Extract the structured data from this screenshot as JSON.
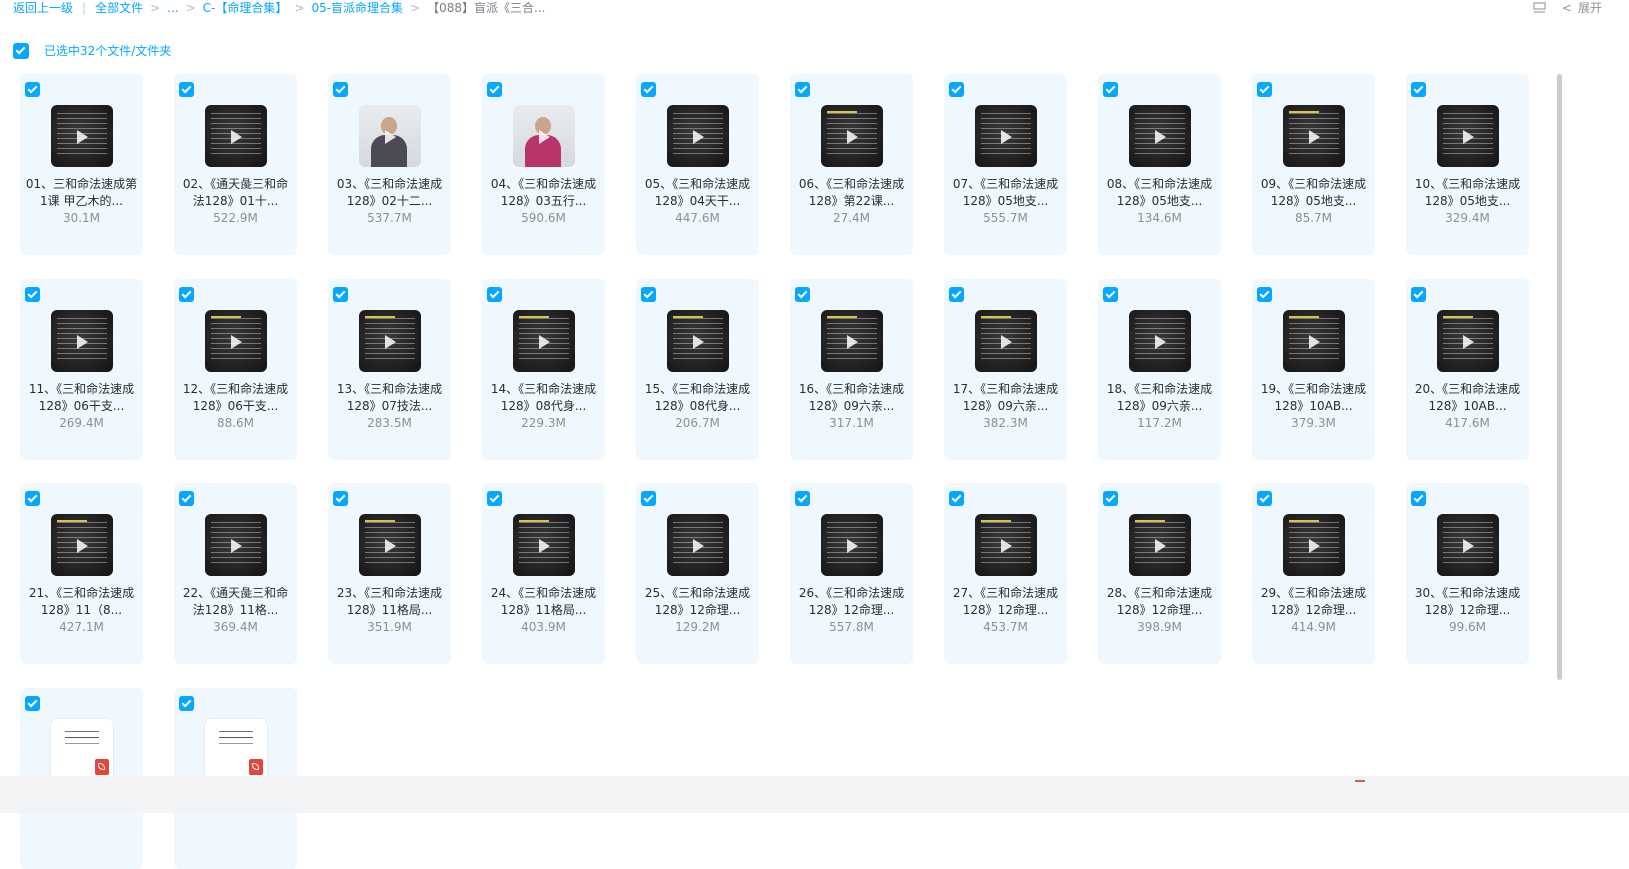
{
  "breadcrumb": {
    "back": "返回上一级",
    "all_files": "全部文件",
    "ellipsis": "...",
    "level1": "C-【命理合集】",
    "level2": "05-盲派命理合集",
    "current": "【088】盲派《三合..."
  },
  "header_right": {
    "expand_label": "展开"
  },
  "selection": {
    "summary": "已选中32个文件/文件夹"
  },
  "files": [
    {
      "name": "01、三和命法速成第1课 甲乙木的...",
      "size": "30.1M",
      "thumb": "dark"
    },
    {
      "name": "02、《通天彘三和命法128》01十...",
      "size": "522.9M",
      "thumb": "dark"
    },
    {
      "name": "03、《三和命法速成128》02十二...",
      "size": "537.7M",
      "thumb": "person"
    },
    {
      "name": "04、《三和命法速成128》03五行...",
      "size": "590.6M",
      "thumb": "person-pink"
    },
    {
      "name": "05、《三和命法速成128》04天干...",
      "size": "447.6M",
      "thumb": "dark"
    },
    {
      "name": "06、《三和命法速成128》第22课...",
      "size": "27.4M",
      "thumb": "dark-hl"
    },
    {
      "name": "07、《三和命法速成128》05地支...",
      "size": "555.7M",
      "thumb": "dark"
    },
    {
      "name": "08、《三和命法速成128》05地支...",
      "size": "134.6M",
      "thumb": "dark"
    },
    {
      "name": "09、《三和命法速成128》05地支...",
      "size": "85.7M",
      "thumb": "dark-hl"
    },
    {
      "name": "10、《三和命法速成128》05地支...",
      "size": "329.4M",
      "thumb": "dark"
    },
    {
      "name": "11、《三和命法速成128》06干支...",
      "size": "269.4M",
      "thumb": "dark"
    },
    {
      "name": "12、《三和命法速成128》06干支...",
      "size": "88.6M",
      "thumb": "dark-hl"
    },
    {
      "name": "13、《三和命法速成128》07技法...",
      "size": "283.5M",
      "thumb": "dark-hl"
    },
    {
      "name": "14、《三和命法速成128》08代身...",
      "size": "229.3M",
      "thumb": "dark-hl"
    },
    {
      "name": "15、《三和命法速成128》08代身...",
      "size": "206.7M",
      "thumb": "dark-hl"
    },
    {
      "name": "16、《三和命法速成128》09六亲...",
      "size": "317.1M",
      "thumb": "dark-hl"
    },
    {
      "name": "17、《三和命法速成128》09六亲...",
      "size": "382.3M",
      "thumb": "dark-hl"
    },
    {
      "name": "18、《三和命法速成128》09六亲...",
      "size": "117.2M",
      "thumb": "dark"
    },
    {
      "name": "19、《三和命法速成128》10AB...",
      "size": "379.3M",
      "thumb": "dark-hl"
    },
    {
      "name": "20、《三和命法速成128》10AB...",
      "size": "417.6M",
      "thumb": "dark-hl"
    },
    {
      "name": "21、《三和命法速成128》11（8...",
      "size": "427.1M",
      "thumb": "dark-hl"
    },
    {
      "name": "22、《通天彘三和命法128》11格...",
      "size": "369.4M",
      "thumb": "dark"
    },
    {
      "name": "23、《三和命法速成128》11格局...",
      "size": "351.9M",
      "thumb": "dark-hl"
    },
    {
      "name": "24、《三和命法速成128》11格局...",
      "size": "403.9M",
      "thumb": "dark-hl"
    },
    {
      "name": "25、《三和命法速成128》12命理...",
      "size": "129.2M",
      "thumb": "dark"
    },
    {
      "name": "26、《三和命法速成128》12命理...",
      "size": "557.8M",
      "thumb": "dark"
    },
    {
      "name": "27、《三和命法速成128》12命理...",
      "size": "453.7M",
      "thumb": "dark-hl"
    },
    {
      "name": "28、《三和命法速成128》12命理...",
      "size": "398.9M",
      "thumb": "dark-hl"
    },
    {
      "name": "29、《三和命法速成128》12命理...",
      "size": "414.9M",
      "thumb": "dark-hl"
    },
    {
      "name": "30、《三和命法速成128》12命理...",
      "size": "99.6M",
      "thumb": "dark"
    },
    {
      "name": "",
      "size": "",
      "thumb": "pdf"
    },
    {
      "name": "",
      "size": "",
      "thumb": "pdf"
    }
  ]
}
